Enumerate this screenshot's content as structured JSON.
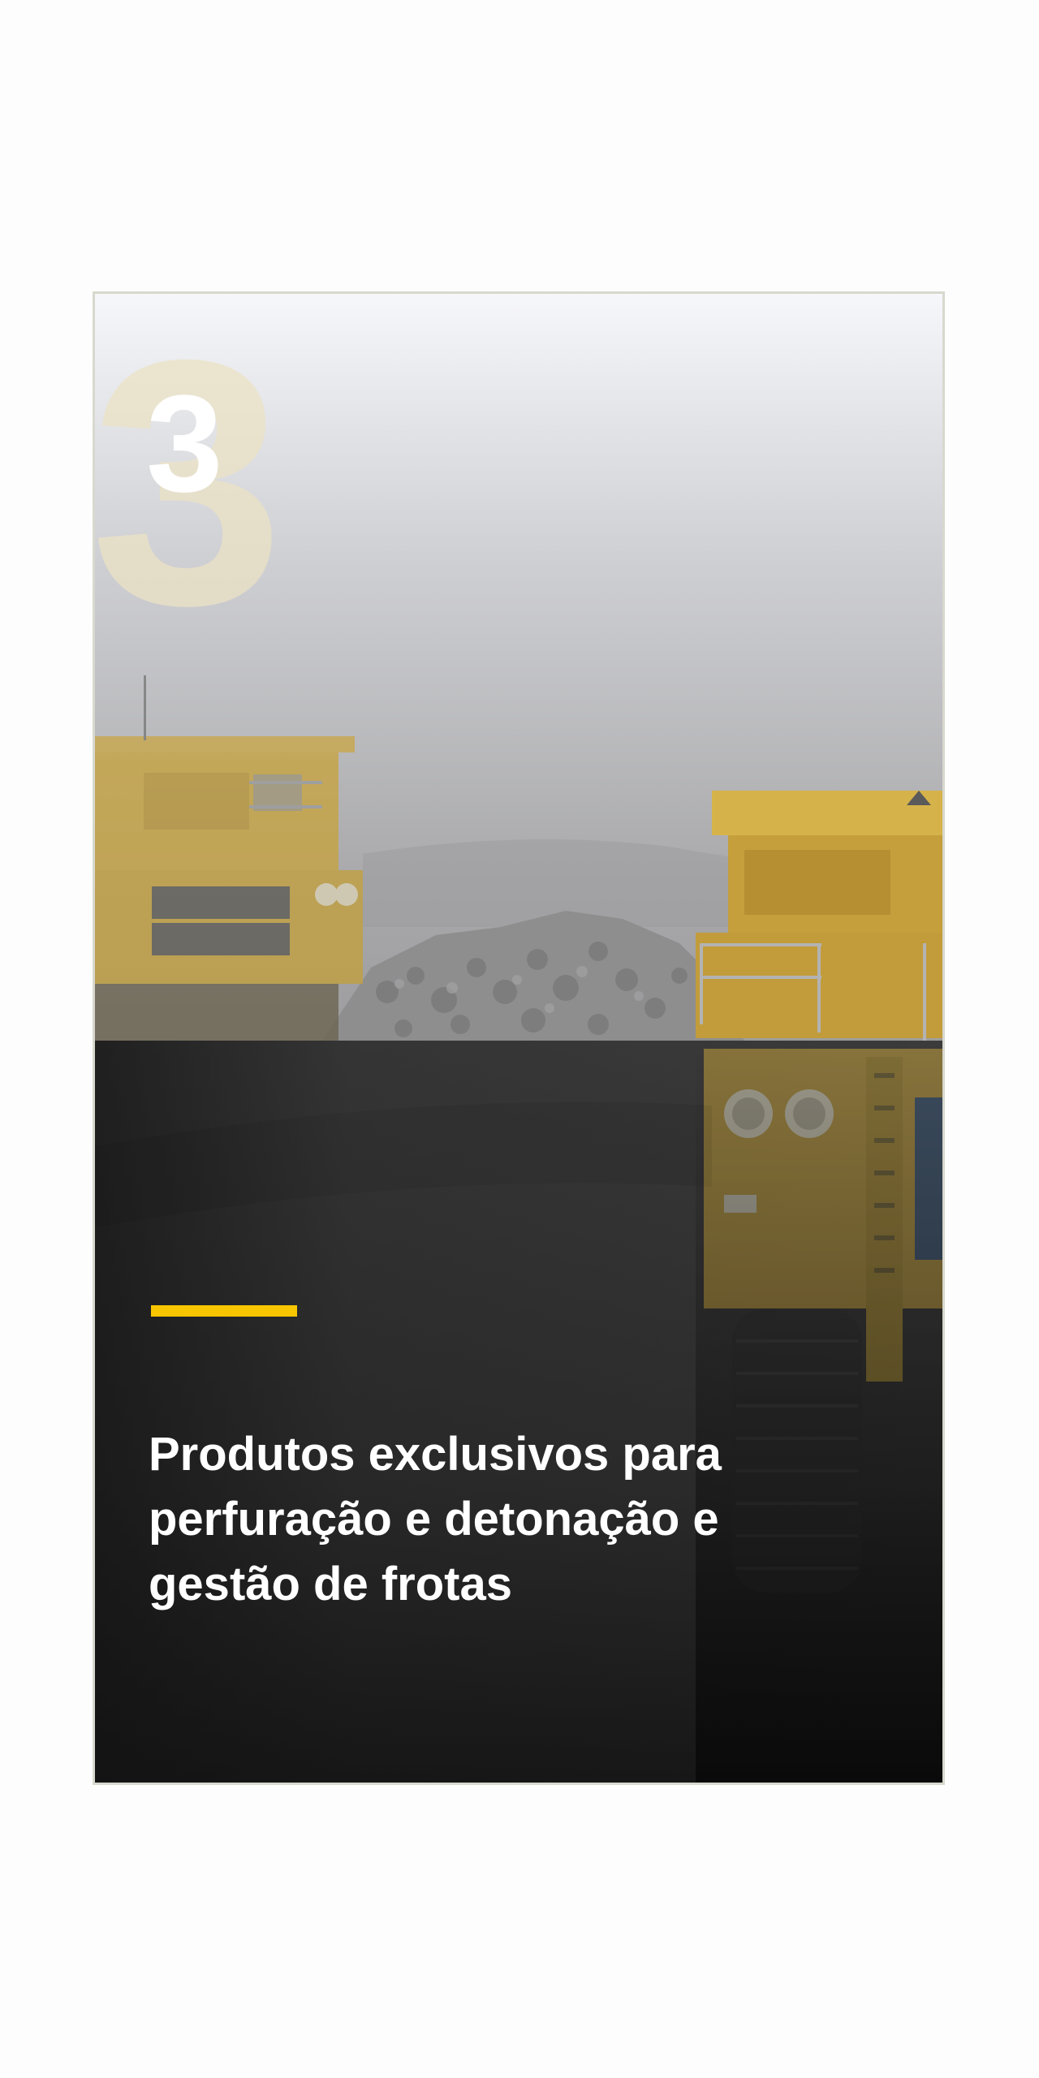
{
  "slide": {
    "number": "3",
    "headline": "Produtos exclusivos para perfuração e detonação e gestão de frotas"
  },
  "colors": {
    "accent": "#f7c600",
    "dark_panel": "#1c1c1c",
    "truck_yellow": "#c9a53a",
    "fog": "#a9a9ab",
    "border": "#d8d8cf"
  },
  "image": {
    "subject": "mining-haul-trucks"
  }
}
